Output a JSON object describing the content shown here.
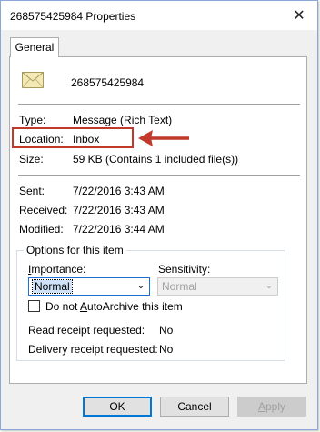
{
  "window": {
    "title": "268575425984 Properties",
    "close_glyph": "✕"
  },
  "tabs": [
    {
      "label": "General"
    }
  ],
  "item": {
    "name": "268575425984",
    "icon": "envelope-icon"
  },
  "details": {
    "type_label": "Type:",
    "type_value": "Message  (Rich Text)",
    "location_label": "Location:",
    "location_value": "Inbox",
    "size_label": "Size:",
    "size_value": "59 KB (Contains 1 included file(s))"
  },
  "dates": {
    "sent_label": "Sent:",
    "sent_value": "7/22/2016 3:43 AM",
    "received_label": "Received:",
    "received_value": "7/22/2016 3:43 AM",
    "modified_label": "Modified:",
    "modified_value": "7/22/2016 3:44 AM"
  },
  "options": {
    "title": "Options for this item",
    "importance_label_first": "I",
    "importance_label_rest": "mportance:",
    "importance_value": "Normal",
    "sensitivity_label": "Sensitivity:",
    "sensitivity_value": "Normal",
    "autoarchive_before": "Do not ",
    "autoarchive_accel": "A",
    "autoarchive_after": "utoArchive this item",
    "autoarchive_checked": false,
    "read_receipt_label": "Read receipt requested:",
    "read_receipt_value": "No",
    "delivery_receipt_label": "Delivery receipt requested:",
    "delivery_receipt_value": "No"
  },
  "buttons": {
    "ok": "OK",
    "cancel": "Cancel",
    "apply_accel": "A",
    "apply_rest": "pply"
  },
  "colors": {
    "highlight_border": "#c0392b",
    "arrow": "#c0392b",
    "focus_accent": "#0078d7"
  }
}
